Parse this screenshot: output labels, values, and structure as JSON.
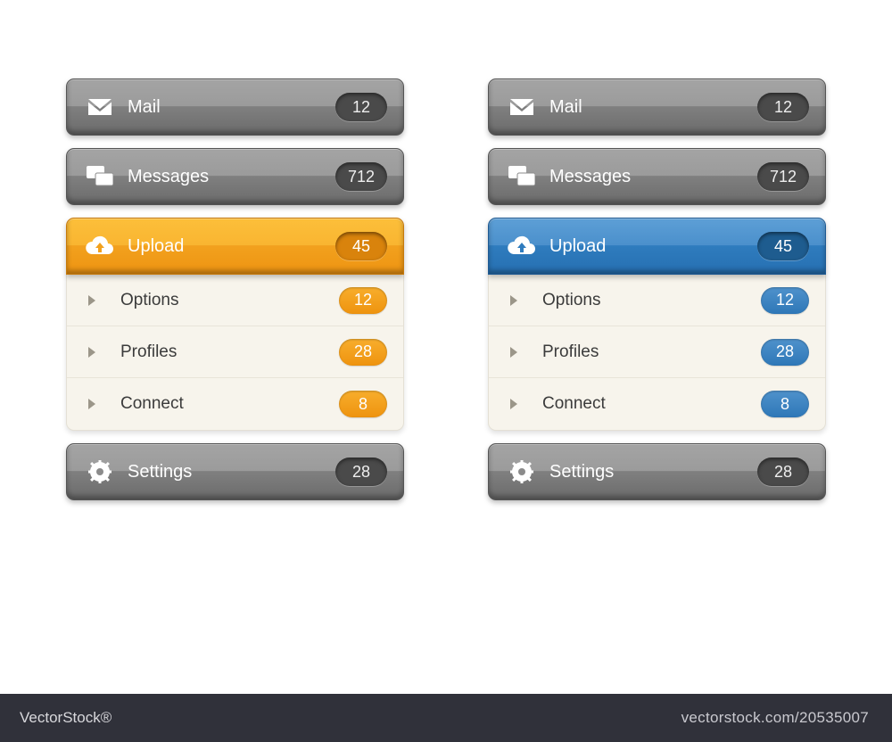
{
  "menus": [
    {
      "accent": "orange",
      "items": [
        {
          "icon": "mail-icon",
          "label": "Mail",
          "count": "12"
        },
        {
          "icon": "chat-icon",
          "label": "Messages",
          "count": "712"
        },
        {
          "icon": "cloud-upload-icon",
          "label": "Upload",
          "count": "45",
          "sub": [
            {
              "label": "Options",
              "count": "12"
            },
            {
              "label": "Profiles",
              "count": "28"
            },
            {
              "label": "Connect",
              "count": "8"
            }
          ]
        },
        {
          "icon": "gear-icon",
          "label": "Settings",
          "count": "28"
        }
      ]
    },
    {
      "accent": "blue",
      "items": [
        {
          "icon": "mail-icon",
          "label": "Mail",
          "count": "12"
        },
        {
          "icon": "chat-icon",
          "label": "Messages",
          "count": "712"
        },
        {
          "icon": "cloud-upload-icon",
          "label": "Upload",
          "count": "45",
          "sub": [
            {
              "label": "Options",
              "count": "12"
            },
            {
              "label": "Profiles",
              "count": "28"
            },
            {
              "label": "Connect",
              "count": "8"
            }
          ]
        },
        {
          "icon": "gear-icon",
          "label": "Settings",
          "count": "28"
        }
      ]
    }
  ],
  "footer": {
    "brand": "VectorStock®",
    "id": "vectorstock.com/20535007"
  }
}
